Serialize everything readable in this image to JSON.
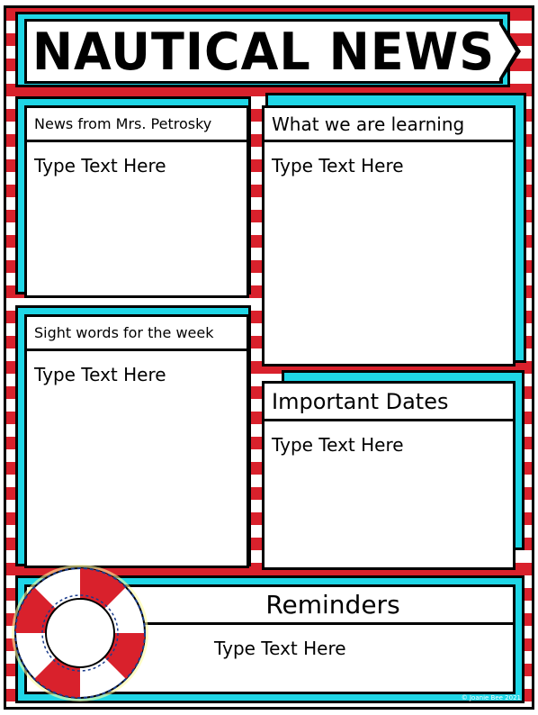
{
  "title": "NAUTICAL NEWS",
  "sections": {
    "news": {
      "label": "News from Mrs. Petrosky",
      "body": "Type Text Here"
    },
    "learning": {
      "label": "What we are learning",
      "body": "Type Text Here"
    },
    "sight_words": {
      "label": "Sight words for the week",
      "body": "Type Text Here"
    },
    "dates": {
      "label": "Important Dates",
      "body": "Type Text Here"
    },
    "reminders": {
      "label": "Reminders",
      "body": "Type Text Here"
    }
  },
  "copyright": "© Joanie Bee 2021",
  "colors": {
    "stripe_red": "#d9212c",
    "frame_cyan": "#1fd6e6",
    "ink": "#000000"
  },
  "icons": [
    "life-ring-icon"
  ]
}
